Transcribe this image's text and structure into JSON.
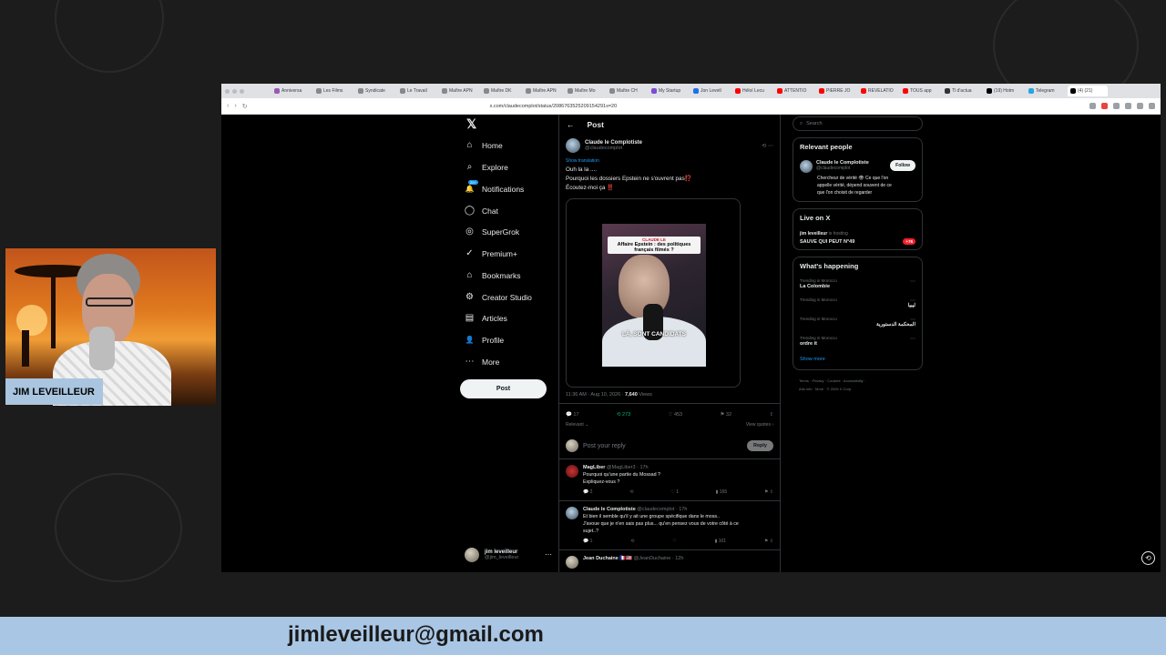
{
  "browser": {
    "tabs": [
      "Anniversa",
      "Les Films",
      "Syndicate",
      "Le Travail",
      "Maître APN",
      "Maître DK",
      "Maître APN",
      "Maître Mo",
      "Maître CH",
      "My Startup",
      "Jon Levetl",
      "Héloï Lecu",
      "ATTENTIO",
      "PIERRE JO",
      "REVELATIO",
      "TOUS app",
      "Tl d'actua",
      "(19) Hotm",
      "Telegram",
      "(4) (21)"
    ],
    "url": "x.com/claudecomplot/status/2086763525209154291s=20"
  },
  "leftnav": {
    "logo": "𝕏",
    "items": [
      {
        "label": "Home",
        "icon": "⌂"
      },
      {
        "label": "Explore",
        "icon": "⌕"
      },
      {
        "label": "Notifications",
        "icon": "🔔"
      },
      {
        "label": "Chat",
        "icon": "◯"
      },
      {
        "label": "SuperGrok",
        "icon": "◎"
      },
      {
        "label": "Premium+",
        "icon": "✓"
      },
      {
        "label": "Bookmarks",
        "icon": "⌂"
      },
      {
        "label": "Creator Studio",
        "icon": "⚙"
      },
      {
        "label": "Articles",
        "icon": "▤"
      },
      {
        "label": "Profile",
        "icon": "👤"
      },
      {
        "label": "More",
        "icon": "⋯"
      }
    ],
    "notif_badge": "20+",
    "post_button": "Post",
    "me_name": "jim leveilleur",
    "me_handle": "@jim_leveilleur"
  },
  "main": {
    "header": "Post",
    "author_name": "Claude le Complotiste",
    "author_handle": "@claudecomplot",
    "translation": "Show translation",
    "text_line1": "Ouh la la ....",
    "text_line2": "Pourquoi les dossiers Epstein ne s'ouvrent pas⁉️",
    "text_line3": "Écoutez-moi ça ‼️",
    "video_tag": "CLAUDE LE",
    "video_caption_top": "Affaire Epstein : des politiques français filmés ?",
    "video_caption_bottom": "LÀ, SONT CANDIDATS",
    "time": "11:36 AM · Aug 10, 2026 · ",
    "views_count": "7,640",
    "views_label": " Views",
    "replies": "17",
    "reposts": "273",
    "likes": "453",
    "bookmarks": "32",
    "relevant": "Relevant ⌄",
    "view_quotes": "View quotes ›",
    "reply_placeholder": "Post your reply",
    "reply_button": "Reply",
    "reply1": {
      "name": "MagLiber",
      "meta": " @MagLiber3 · 17h",
      "text1": "Pourquoi qu'une partie du Mossad ?",
      "text2": "Expliquez-vous ?",
      "r": "2",
      "l": "1",
      "v": "165"
    },
    "reply2": {
      "name": "Claude le Complotiste",
      "meta": " @claudecomplot · 17h",
      "text1": "Et bien il semble qu'il y ait une groupe spécifique dans le moss..",
      "text2": "J'avoue que je n'en sais pas plus... qu'en pensez vous de votre côté à ce",
      "text3": "sujet..?",
      "r": "1",
      "v": "101"
    },
    "reply3": {
      "name": "Jean Duchaine",
      "meta": " 🇫🇷🇺🇸 @JeanDuchaine · 12h"
    }
  },
  "right": {
    "search_placeholder": "Search",
    "relevant_title": "Relevant people",
    "rp_name": "Claude le Complotiste",
    "rp_handle": "@claudecomplot",
    "follow": "Follow",
    "rp_bio1": "Chercheur de vérité 👁 Ce que l'on",
    "rp_bio2": "appelle vérité, dépend souvent de ce",
    "rp_bio3": "que l'on choisit de regarder",
    "live_title": "Live on X",
    "live_host": "jim leveilleur",
    "live_hosting": " is hosting",
    "live_name": "SAUVE QUI PEUT N°49",
    "live_count": "+76",
    "happening_title": "What's happening",
    "trends": [
      {
        "ctx": "Trending in Morocco",
        "name": "La Colombie",
        "rtl": false
      },
      {
        "ctx": "Trending in Morocco",
        "name": "ليبيا",
        "rtl": true
      },
      {
        "ctx": "Trending in Morocco",
        "name": "المحكمة الدستورية",
        "rtl": true
      },
      {
        "ctx": "Trending in Morocco",
        "name": "ordre it",
        "rtl": false
      }
    ],
    "show_more": "Show more",
    "footer1": "Terms · Privacy · Cookies · Accessibility ·",
    "footer2": "Ads info · More · © 2026 X Corp."
  },
  "webcam": {
    "label": "JIM LEVEILLEUR"
  },
  "banner": {
    "email": "jimleveilleur@gmail.com"
  }
}
